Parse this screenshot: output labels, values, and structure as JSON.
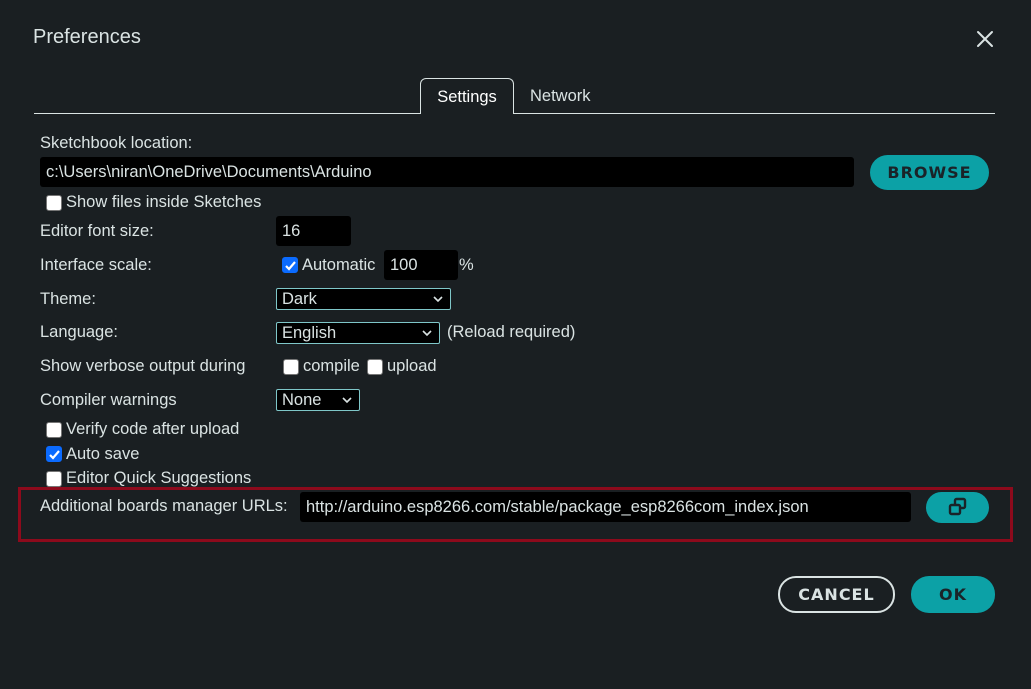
{
  "dialog": {
    "title": "Preferences",
    "close_icon": "close-icon"
  },
  "tabs": [
    {
      "label": "Settings",
      "active": true
    },
    {
      "label": "Network",
      "active": false
    }
  ],
  "settings": {
    "sketchbook": {
      "label": "Sketchbook location:",
      "value": "c:\\Users\\niran\\OneDrive\\Documents\\Arduino",
      "browse_label": "BROWSE"
    },
    "show_files": {
      "label": "Show files inside Sketches",
      "checked": false
    },
    "font_size": {
      "label": "Editor font size:",
      "value": "16"
    },
    "interface_scale": {
      "label": "Interface scale:",
      "automatic_label": "Automatic",
      "automatic_checked": true,
      "value": "100",
      "unit": "%"
    },
    "theme": {
      "label": "Theme:",
      "value": "Dark"
    },
    "language": {
      "label": "Language:",
      "value": "English",
      "note": "(Reload required)"
    },
    "verbose": {
      "label": "Show verbose output during",
      "compile_label": "compile",
      "compile_checked": false,
      "upload_label": "upload",
      "upload_checked": false
    },
    "compiler_warnings": {
      "label": "Compiler warnings",
      "value": "None"
    },
    "verify": {
      "label": "Verify code after upload",
      "checked": false
    },
    "auto_save": {
      "label": "Auto save",
      "checked": true
    },
    "quick_suggestions": {
      "label": "Editor Quick Suggestions",
      "checked": false
    },
    "boards_urls": {
      "label": "Additional boards manager URLs:",
      "value": "http://arduino.esp8266.com/stable/package_esp8266com_index.json",
      "edit_icon": "open-window-icon"
    }
  },
  "footer": {
    "cancel_label": "CANCEL",
    "ok_label": "OK"
  },
  "colors": {
    "background": "#1a1f22",
    "accent": "#0ca1a6",
    "highlight_border": "#8d0a1c",
    "checkbox_checked": "#0b6bff"
  }
}
